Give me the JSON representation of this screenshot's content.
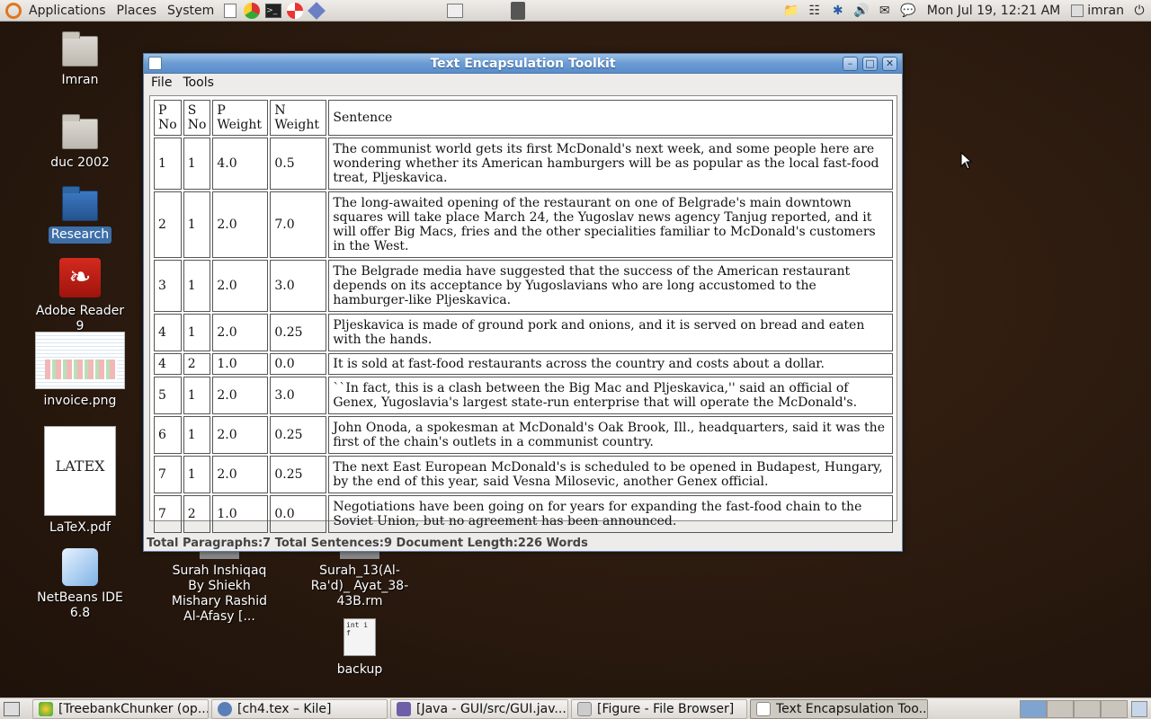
{
  "top_panel": {
    "menus": [
      "Applications",
      "Places",
      "System"
    ],
    "clock": "Mon Jul 19, 12:21 AM",
    "user": "imran"
  },
  "desktop": {
    "icons": [
      "Imran",
      "duc 2002",
      "Research",
      "Adobe Reader 9",
      "invoice.png",
      "LaTeX.pdf",
      "NetBeans IDE 6.8"
    ],
    "icons2": [
      "Surah Inshiqaq By Shiekh Mishary Rashid Al-Afasy [...",
      "Surah_13(Al-Ra'd)_ Ayat_38-43B.rm",
      "backup"
    ],
    "latex_thumb": "LATEX"
  },
  "window": {
    "title": "Text Encapsulation Toolkit",
    "menus": [
      "File",
      "Tools"
    ],
    "headers": [
      "P No",
      "S No",
      "P Weight",
      "N Weight",
      "Sentence"
    ],
    "rows": [
      [
        "1",
        "1",
        "4.0",
        "0.5",
        "The communist world gets its first McDonald's next week, and some people here are wondering whether its American hamburgers will be as popular as the local fast-food treat, Pljeskavica."
      ],
      [
        "2",
        "1",
        "2.0",
        "7.0",
        "The long-awaited opening of the restaurant on one of Belgrade's main downtown squares will take place March 24, the Yugoslav news agency Tanjug reported, and it will offer Big Macs, fries and the other specialities familiar to McDonald's customers in the West."
      ],
      [
        "3",
        "1",
        "2.0",
        "3.0",
        "The Belgrade media have suggested that the success of the American restaurant depends on its acceptance by Yugoslavians who are long accustomed to the hamburger-like Pljeskavica."
      ],
      [
        "4",
        "1",
        "2.0",
        "0.25",
        "Pljeskavica is made of ground pork and onions, and it is served on bread and eaten with the hands."
      ],
      [
        "4",
        "2",
        "1.0",
        "0.0",
        "It is sold at fast-food restaurants across the country and costs about a dollar."
      ],
      [
        "5",
        "1",
        "2.0",
        "3.0",
        "``In fact, this is a clash between the Big Mac and Pljeskavica,'' said an official of Genex, Yugoslavia's largest state-run enterprise that will operate the McDonald's."
      ],
      [
        "6",
        "1",
        "2.0",
        "0.25",
        "John Onoda, a spokesman at McDonald's Oak Brook, Ill., headquarters, said it was the first of the chain's outlets in a communist country."
      ],
      [
        "7",
        "1",
        "2.0",
        "0.25",
        "The next East European McDonald's is scheduled to be opened in Budapest, Hungary, by the end of this year, said Vesna Milosevic, another Genex official."
      ],
      [
        "7",
        "2",
        "1.0",
        "0.0",
        "Negotiations have been going on for years for expanding the fast-food chain to the Soviet Union, but no agreement has been announced."
      ]
    ],
    "status": "Total Paragraphs:7 Total Sentences:9 Document Length:226 Words"
  },
  "taskbar": {
    "tasks": [
      "[TreebankChunker (op...",
      "[ch4.tex – Kile]",
      "[Java - GUI/src/GUI.jav...",
      "[Figure - File Browser]",
      "Text Encapsulation Too..."
    ]
  }
}
